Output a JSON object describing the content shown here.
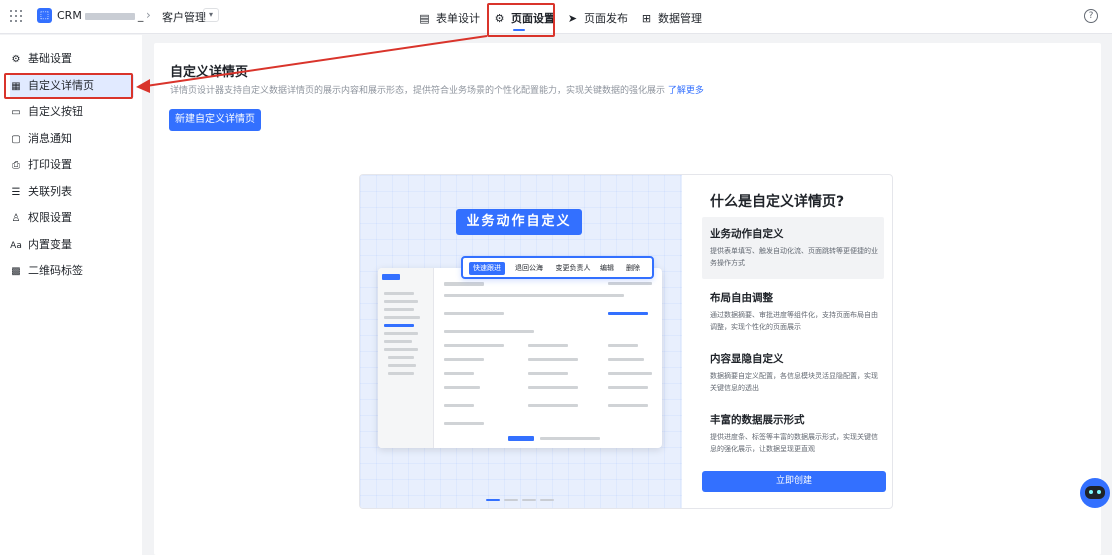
{
  "topbar": {
    "app_logo_text": "⬚",
    "app_name_prefix": "CRM",
    "app_name_suffix": "_",
    "crumb_sep": "›",
    "crumb_item": "客户管理",
    "crumb_dropdown": "▾",
    "tabs": [
      {
        "label": "表单设计",
        "icon": "document-icon"
      },
      {
        "label": "页面设置",
        "icon": "gear-icon",
        "active": true
      },
      {
        "label": "页面发布",
        "icon": "send-icon"
      },
      {
        "label": "数据管理",
        "icon": "table-icon"
      }
    ],
    "help": "?"
  },
  "sidebar": {
    "items": [
      {
        "label": "基础设置",
        "icon": "gear-icon"
      },
      {
        "label": "自定义详情页",
        "icon": "detail-page-icon",
        "active": true
      },
      {
        "label": "自定义按钮",
        "icon": "button-icon"
      },
      {
        "label": "消息通知",
        "icon": "message-icon"
      },
      {
        "label": "打印设置",
        "icon": "printer-icon"
      },
      {
        "label": "关联列表",
        "icon": "list-icon"
      },
      {
        "label": "权限设置",
        "icon": "user-icon"
      },
      {
        "label": "内置变量",
        "icon": "variable-icon"
      },
      {
        "label": "二维码标签",
        "icon": "qrcode-icon"
      }
    ]
  },
  "main": {
    "title": "自定义详情页",
    "desc": "详情页设计器支持自定义数据详情页的展示内容和展示形态，提供符合业务场景的个性化配置能力，实现关键数据的强化展示",
    "desc_link": "了解更多",
    "new_button": "新建自定义详情页"
  },
  "intro": {
    "banner": "业务动作自定义",
    "actions": [
      "快速跟进",
      "退回公海",
      "变更负责人",
      "编辑",
      "删除"
    ],
    "question": "什么是自定义详情页?",
    "features": [
      {
        "title": "业务动作自定义",
        "desc": "提供表单填写、触发自动化流、页面跳转等更便捷的业务操作方式",
        "active": true
      },
      {
        "title": "布局自由调整",
        "desc": "通过数据摘要、审批进度等组件化，支持页面布局自由调整，实现个性化的页面展示"
      },
      {
        "title": "内容显隐自定义",
        "desc": "数据摘要自定义配置，各信息模块灵活显隐配置，实现关键信息的透出"
      },
      {
        "title": "丰富的数据展示形式",
        "desc": "提供进度条、标签等丰富的数据展示形式，实现关键信息的强化展示，让数据呈现更直观"
      }
    ],
    "create_button": "立即创建",
    "carousel_active_index": 0
  },
  "colors": {
    "accent": "#3370ff",
    "annotation": "#d9342b"
  }
}
